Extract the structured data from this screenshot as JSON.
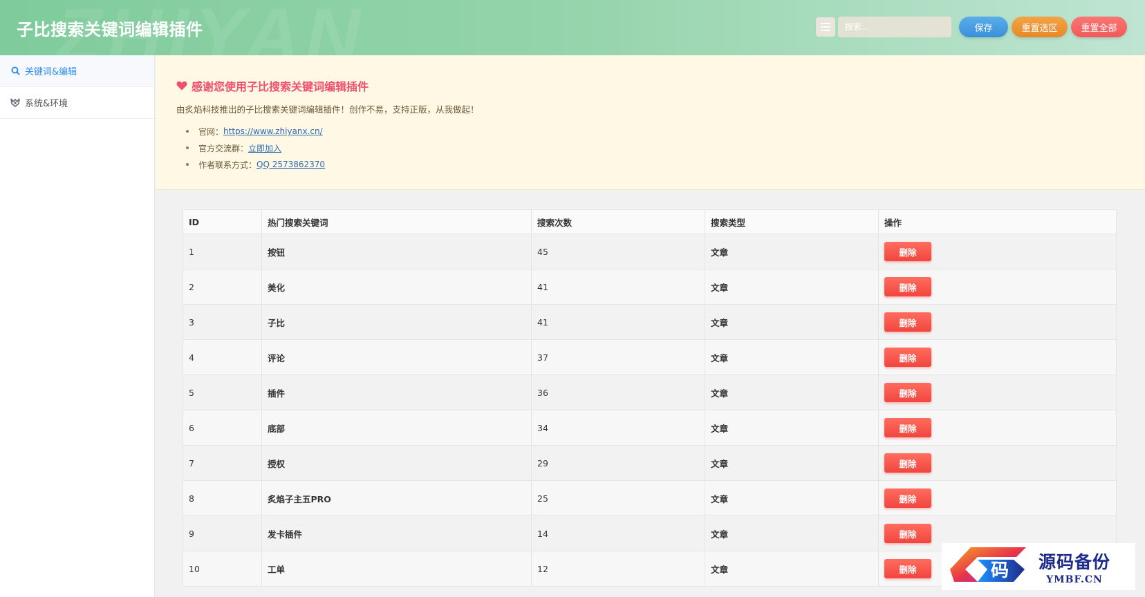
{
  "header": {
    "title": "子比搜索关键词编辑插件",
    "watermark": "ZHIYAN",
    "search_placeholder": "搜索...",
    "save_label": "保存",
    "reset_selection_label": "重置选区",
    "reset_all_label": "重置全部"
  },
  "sidebar": {
    "items": [
      {
        "label": "关键词&编辑",
        "icon": "search-icon",
        "active": true
      },
      {
        "label": "系统&环境",
        "icon": "settings-icon",
        "active": false
      }
    ]
  },
  "notice": {
    "title": "感谢您使用子比搜索关键词编辑插件",
    "description": "由炙焰科技推出的子比搜索关键词编辑插件！创作不易，支持正版，从我做起！",
    "links": [
      {
        "label": "官网：",
        "link_text": "https://www.zhiyanx.cn/"
      },
      {
        "label": "官方交流群：",
        "link_text": "立即加入"
      },
      {
        "label": "作者联系方式：",
        "link_text": "QQ 2573862370"
      }
    ]
  },
  "table": {
    "headers": [
      "ID",
      "热门搜索关键词",
      "搜索次数",
      "搜索类型",
      "操作"
    ],
    "delete_label": "删除",
    "rows": [
      {
        "id": "1",
        "keyword": "按钮",
        "count": "45",
        "type": "文章"
      },
      {
        "id": "2",
        "keyword": "美化",
        "count": "41",
        "type": "文章"
      },
      {
        "id": "3",
        "keyword": "子比",
        "count": "41",
        "type": "文章"
      },
      {
        "id": "4",
        "keyword": "评论",
        "count": "37",
        "type": "文章"
      },
      {
        "id": "5",
        "keyword": "插件",
        "count": "36",
        "type": "文章"
      },
      {
        "id": "6",
        "keyword": "底部",
        "count": "34",
        "type": "文章"
      },
      {
        "id": "7",
        "keyword": "授权",
        "count": "29",
        "type": "文章"
      },
      {
        "id": "8",
        "keyword": "炙焰子主五PRO",
        "count": "25",
        "type": "文章"
      },
      {
        "id": "9",
        "keyword": "发卡插件",
        "count": "14",
        "type": "文章"
      },
      {
        "id": "10",
        "keyword": "工单",
        "count": "12",
        "type": "文章"
      }
    ]
  },
  "watermark_logo": {
    "glyph": "码",
    "cn": "源码备份",
    "en": "YMBF.CN"
  },
  "colors": {
    "header_start": "#7fcb9b",
    "accent_blue": "#2d8ff0",
    "save": "#4a9fe2",
    "reset_selection": "#ee962f",
    "reset_all": "#f56866",
    "delete": "#f5534a",
    "notice_bg": "#fef8e4",
    "notice_title": "#ef4f6b"
  }
}
